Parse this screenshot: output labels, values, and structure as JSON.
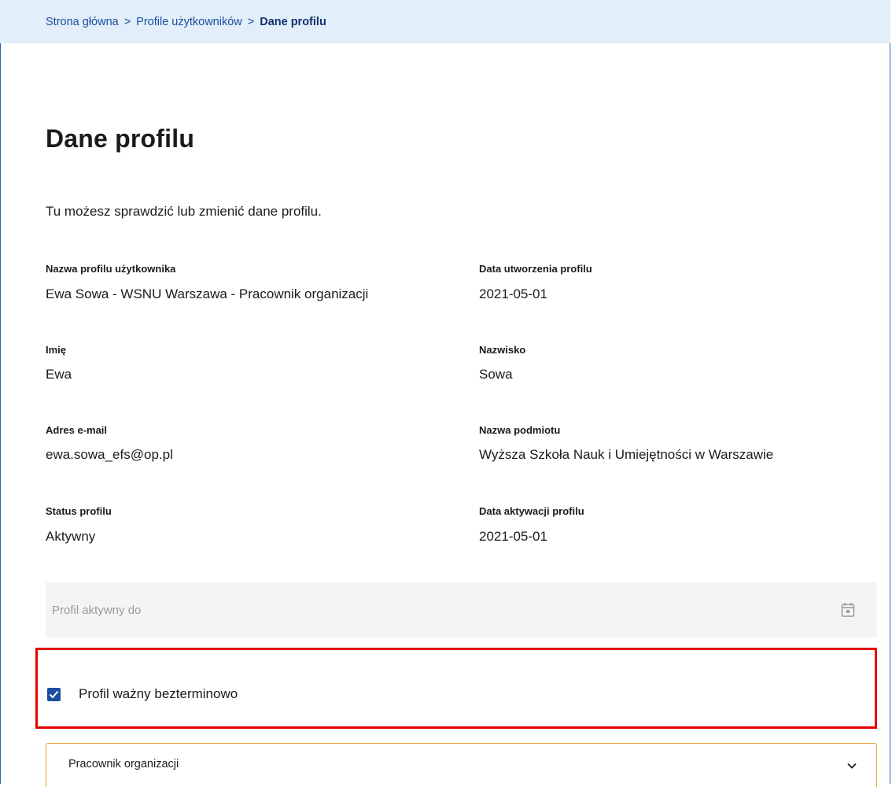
{
  "breadcrumb": {
    "items": [
      "Strona główna",
      "Profile użytkowników"
    ],
    "separator": ">",
    "current": "Dane profilu"
  },
  "page": {
    "title": "Dane profilu",
    "intro": "Tu możesz sprawdzić lub zmienić dane profilu."
  },
  "fields": {
    "profile_name": {
      "label": "Nazwa profilu użytkownika",
      "value": "Ewa Sowa - WSNU Warszawa - Pracownik organizacji"
    },
    "created_date": {
      "label": "Data utworzenia profilu",
      "value": "2021-05-01"
    },
    "first_name": {
      "label": "Imię",
      "value": "Ewa"
    },
    "last_name": {
      "label": "Nazwisko",
      "value": "Sowa"
    },
    "email": {
      "label": "Adres e-mail",
      "value": "ewa.sowa_efs@op.pl"
    },
    "entity_name": {
      "label": "Nazwa podmiotu",
      "value": "Wyższa Szkoła Nauk i Umiejętności w Warszawie"
    },
    "status": {
      "label": "Status profilu",
      "value": "Aktywny"
    },
    "activation_date": {
      "label": "Data aktywacji profilu",
      "value": "2021-05-01"
    }
  },
  "active_until": {
    "placeholder": "Profil aktywny do",
    "icon": "calendar-icon"
  },
  "indefinite": {
    "label": "Profil ważny bezterminowo",
    "checked": true
  },
  "role_select": {
    "value": "Pracownik organizacji",
    "icon": "chevron-down-icon"
  },
  "colors": {
    "accent": "#1a4fa0",
    "breadcrumb_bg": "#e2eef9",
    "highlight": "#e60000",
    "select_border": "#e8a33a"
  }
}
